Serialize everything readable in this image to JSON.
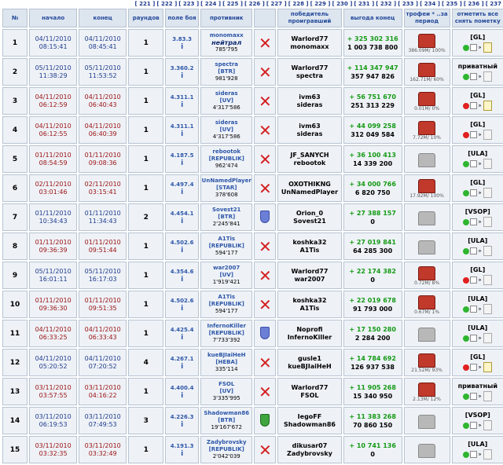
{
  "pager": [
    "[ 221 ]",
    "[ 222 ]",
    "[ 223 ]",
    "[ 224 ]",
    "[ 225 ]",
    "[ 226 ]",
    "[ 227 ]",
    "[ 228 ]",
    "[ 229 ]",
    "[ 230 ]",
    "[ 231 ]",
    "[ 232 ]",
    "[ 233 ]",
    "[ 234 ]",
    "[ 235 ]",
    "[ 236 ]",
    "[ 237"
  ],
  "headers": {
    "num": "№",
    "start": "начало",
    "end": "конец",
    "rounds": "раундов",
    "field": "поле боя",
    "opponent": "противник",
    "winner": "победитель проигравший",
    "gain": "выгода конец",
    "trophy": "трофеи * ..за период",
    "action": "отметить все снять пометку"
  },
  "rows": [
    {
      "n": "1",
      "s1": "04/11/2010",
      "s2": "08:15:41",
      "e1": "04/11/2010",
      "e2": "08:45:41",
      "r": "1",
      "f": "3.83.3",
      "on": "monomaxx",
      "oi": true,
      "oc": "нейтрал",
      "or": "785'795",
      "res": "x",
      "w": "Warlord77",
      "l": "monomaxx",
      "g": "+ 325 302 316",
      "t": "1 003 738 800",
      "tc": "red",
      "tcap": "386.09M/ 100%",
      "tag": "[GL]",
      "dot": "green",
      "note": true,
      "dc": "blue"
    },
    {
      "n": "2",
      "s1": "05/11/2010",
      "s2": "11:38:29",
      "e1": "05/11/2010",
      "e2": "11:53:52",
      "r": "1",
      "f": "3.360.2",
      "on": "spectra",
      "oi": false,
      "oc": "[BTR]",
      "or": "981'928",
      "res": "x",
      "w": "Warlord77",
      "l": "spectra",
      "g": "+ 114 347 947",
      "t": "357 947 826",
      "tc": "red",
      "tcap": "162.71M/ 60%",
      "tag": "приватный",
      "dot": "green",
      "note": false,
      "dc": "blue"
    },
    {
      "n": "3",
      "s1": "04/11/2010",
      "s2": "06:12:59",
      "e1": "04/11/2010",
      "e2": "06:40:43",
      "r": "1",
      "f": "4.311.1",
      "on": "sideras",
      "oi": false,
      "oc": "[UV]",
      "or": "4'317'586",
      "res": "x",
      "w": "ivm63",
      "l": "sideras",
      "g": "+ 56 751 670",
      "t": "251 313 229",
      "tc": "red",
      "tcap": "0.01M/ 0%",
      "tag": "[GL]",
      "dot": "red",
      "note": true,
      "dc": "red"
    },
    {
      "n": "4",
      "s1": "04/11/2010",
      "s2": "06:12:55",
      "e1": "04/11/2010",
      "e2": "06:40:39",
      "r": "1",
      "f": "4.311.1",
      "on": "sideras",
      "oi": false,
      "oc": "[UV]",
      "or": "4'317'586",
      "res": "x",
      "w": "ivm63",
      "l": "sideras",
      "g": "+ 44 099 258",
      "t": "312 049 584",
      "tc": "red",
      "tcap": "7.72M/ 10%",
      "tag": "[GL]",
      "dot": "red",
      "note": false,
      "dc": "red"
    },
    {
      "n": "5",
      "s1": "01/11/2010",
      "s2": "08:54:59",
      "e1": "01/11/2010",
      "e2": "09:08:36",
      "r": "1",
      "f": "4.187.5",
      "on": "rebootok",
      "oi": false,
      "oc": "[REPUBLIK]",
      "or": "962'474",
      "res": "x",
      "w": "JF_SANYCH",
      "l": "rebootok",
      "g": "+ 36 100 413",
      "t": "14 339 200",
      "tc": "grey",
      "tcap": "",
      "tag": "[ULA]",
      "dot": "green",
      "note": false,
      "dc": "red"
    },
    {
      "n": "6",
      "s1": "02/11/2010",
      "s2": "03:01:46",
      "e1": "02/11/2010",
      "e2": "03:15:41",
      "r": "1",
      "f": "4.497.4",
      "on": "UnNamedPlayer",
      "oi": false,
      "oc": "[STAR]",
      "or": "378'608",
      "res": "x",
      "w": "OXOTHIKNG",
      "l": "UnNamedPlayer",
      "g": "+ 34 000 766",
      "t": "6 820 750",
      "tc": "red",
      "tcap": "17.92M/ 100%",
      "tag": "[GL]",
      "dot": "green",
      "note": false,
      "dc": "red"
    },
    {
      "n": "7",
      "s1": "01/11/2010",
      "s2": "10:34:43",
      "e1": "01/11/2010",
      "e2": "11:34:43",
      "r": "2",
      "f": "4.454.1",
      "on": "Sovest21",
      "oi": false,
      "oc": "[BTR]",
      "or": "2'245'841",
      "res": "blue",
      "w": "Orion_0",
      "l": "Sovest21",
      "g": "+ 27 388 157",
      "t": "0",
      "tc": "grey",
      "tcap": "",
      "tag": "[VSOP]",
      "dot": "green",
      "note": false,
      "dc": "blue"
    },
    {
      "n": "8",
      "s1": "01/11/2010",
      "s2": "09:36:39",
      "e1": "01/11/2010",
      "e2": "09:51:44",
      "r": "1",
      "f": "4.502.6",
      "on": "A1Tis",
      "oi": false,
      "oc": "[REPUBLIK]",
      "or": "594'177",
      "res": "x",
      "w": "koshka32",
      "l": "A1Tis",
      "g": "+ 27 019 841",
      "t": "64 285 300",
      "tc": "grey",
      "tcap": "",
      "tag": "[ULA]",
      "dot": "green",
      "note": false,
      "dc": "red"
    },
    {
      "n": "9",
      "s1": "05/11/2010",
      "s2": "16:01:11",
      "e1": "05/11/2010",
      "e2": "16:17:03",
      "r": "1",
      "f": "4.354.6",
      "on": "war2007",
      "oi": false,
      "oc": "[UV]",
      "or": "1'919'421",
      "res": "x",
      "w": "Warlord77",
      "l": "war2007",
      "g": "+ 22 174 382",
      "t": "0",
      "tc": "red",
      "tcap": "0.72M/ 8%",
      "tag": "[GL]",
      "dot": "red",
      "note": false,
      "dc": "blue"
    },
    {
      "n": "10",
      "s1": "01/11/2010",
      "s2": "09:36:30",
      "e1": "01/11/2010",
      "e2": "09:51:35",
      "r": "1",
      "f": "4.502.6",
      "on": "A1Tis",
      "oi": false,
      "oc": "[REPUBLIK]",
      "or": "594'177",
      "res": "x",
      "w": "koshka32",
      "l": "A1Tis",
      "g": "+ 22 019 678",
      "t": "91 793 000",
      "tc": "red",
      "tcap": "0.67M/ 1%",
      "tag": "[ULA]",
      "dot": "green",
      "note": false,
      "dc": "red"
    },
    {
      "n": "11",
      "s1": "04/11/2010",
      "s2": "06:33:25",
      "e1": "04/11/2010",
      "e2": "06:33:43",
      "r": "1",
      "f": "4.425.4",
      "on": "InfernoKiller",
      "oi": false,
      "oc": "[REPUBLIK]",
      "or": "7'733'392",
      "res": "blue",
      "w": "Noprofi",
      "l": "InfernoKiller",
      "g": "+ 17 150 280",
      "t": "2 284 200",
      "tc": "grey",
      "tcap": "",
      "tag": "[ULA]",
      "dot": "green",
      "note": false,
      "dc": "red"
    },
    {
      "n": "12",
      "s1": "04/11/2010",
      "s2": "05:20:52",
      "e1": "04/11/2010",
      "e2": "07:20:52",
      "r": "4",
      "f": "4.267.1",
      "on": "kueBJIaiHeH",
      "oi": false,
      "oc": "[HEBA]",
      "or": "335'114",
      "res": "x",
      "w": "gusle1",
      "l": "kueBJIaiHeH",
      "g": "+ 14 784 692",
      "t": "126 937 538",
      "tc": "red",
      "tcap": "21.52M/ 93%",
      "tag": "[GL]",
      "dot": "red",
      "note": true,
      "dc": "blue"
    },
    {
      "n": "13",
      "s1": "03/11/2010",
      "s2": "03:57:55",
      "e1": "03/11/2010",
      "e2": "04:16:22",
      "r": "1",
      "f": "4.400.4",
      "on": "FSOL",
      "oi": false,
      "oc": "[UV]",
      "or": "3'335'995",
      "res": "x",
      "w": "Warlord77",
      "l": "FSOL",
      "g": "+ 11 905 268",
      "t": "15 340 950",
      "tc": "red",
      "tcap": "2.13M/ 12%",
      "tag": "приватный",
      "dot": "green",
      "note": false,
      "dc": "red"
    },
    {
      "n": "14",
      "s1": "03/11/2010",
      "s2": "06:19:53",
      "e1": "03/11/2010",
      "e2": "07:49:53",
      "r": "3",
      "f": "4.226.3",
      "on": "Shadowman86",
      "oi": false,
      "oc": "[BTR]",
      "or": "19'167'672",
      "res": "green",
      "w": "IegoFF",
      "l": "Shadowman86",
      "g": "+ 11 383 268",
      "t": "70 860 150",
      "tc": "grey",
      "tcap": "",
      "tag": "[VSOP]",
      "dot": "green",
      "note": false,
      "dc": "blue"
    },
    {
      "n": "15",
      "s1": "03/11/2010",
      "s2": "03:32:35",
      "e1": "03/11/2010",
      "e2": "03:32:49",
      "r": "1",
      "f": "4.191.3",
      "on": "Zadybrovsky",
      "oi": false,
      "oc": "[REPUBLIK]",
      "or": "2'042'039",
      "res": "x",
      "w": "dikusar07",
      "l": "Zadybrovsky",
      "g": "+ 10 741 136",
      "t": "0",
      "tc": "grey",
      "tcap": "",
      "tag": "[ULA]",
      "dot": "green",
      "note": false,
      "dc": "red"
    }
  ],
  "labels": {
    "field_i": "i",
    "arrow": "»"
  },
  "colors": {
    "header_text": "#244a9a",
    "cell_bg": "#eef2f7",
    "gain_green": "#159a15",
    "lose_red": "#d42020"
  }
}
